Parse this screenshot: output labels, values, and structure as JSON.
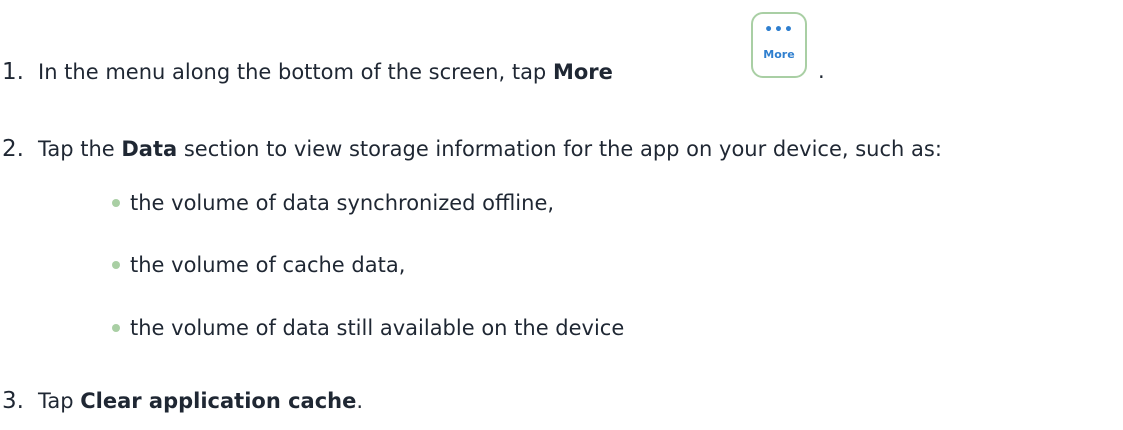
{
  "steps": [
    {
      "number": "1.",
      "text_before": "In the menu along the bottom of the screen, tap ",
      "bold": "More",
      "text_after": " ",
      "button": {
        "icon": "more-dots-icon",
        "dots": "•••",
        "label": "More"
      },
      "trailing": "."
    },
    {
      "number": "2.",
      "text_before": "Tap the ",
      "bold": "Data",
      "text_after": " section to view storage information for the app on your device, such as:"
    },
    {
      "number": "3.",
      "text_before": "Tap ",
      "bold": "Clear application cache",
      "text_after": "."
    }
  ],
  "bullets": [
    "the volume of data synchronized offline,",
    "the volume of cache data,",
    "the volume of data still available on the device"
  ],
  "colors": {
    "text": "#1f2733",
    "accent_blue": "#2f7fcf",
    "accent_green": "#a9cfa4"
  }
}
